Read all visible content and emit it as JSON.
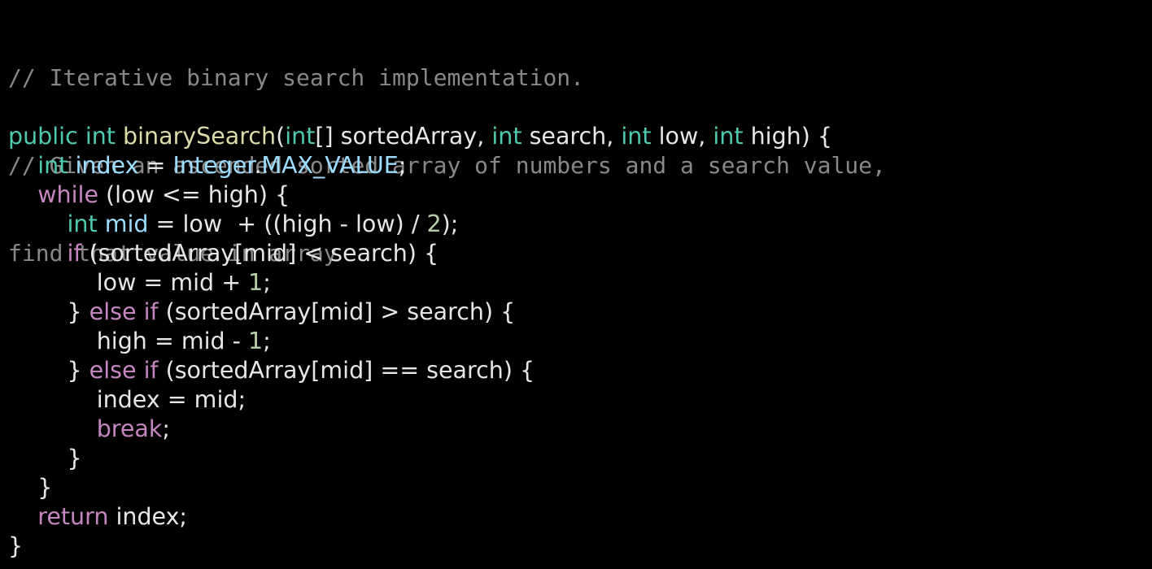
{
  "comment_lines": [
    "// Iterative binary search implementation.",
    "// Given an ascended sorted array of numbers and a search value,",
    "find that value in array"
  ],
  "code_lines": [
    [
      {
        "t": "public",
        "c": "kw"
      },
      {
        "t": " ",
        "c": "pl"
      },
      {
        "t": "int",
        "c": "kw"
      },
      {
        "t": " ",
        "c": "pl"
      },
      {
        "t": "binarySearch",
        "c": "fn"
      },
      {
        "t": "(",
        "c": "pl"
      },
      {
        "t": "int",
        "c": "kw"
      },
      {
        "t": "[] sortedArray, ",
        "c": "pl"
      },
      {
        "t": "int",
        "c": "kw"
      },
      {
        "t": " search, ",
        "c": "pl"
      },
      {
        "t": "int",
        "c": "kw"
      },
      {
        "t": " low, ",
        "c": "pl"
      },
      {
        "t": "int",
        "c": "kw"
      },
      {
        "t": " high) {",
        "c": "pl"
      }
    ],
    [
      {
        "t": "    ",
        "c": "pl"
      },
      {
        "t": "int",
        "c": "kw"
      },
      {
        "t": " ",
        "c": "pl"
      },
      {
        "t": "index",
        "c": "var"
      },
      {
        "t": " = ",
        "c": "pl"
      },
      {
        "t": "Integer",
        "c": "var"
      },
      {
        "t": ".",
        "c": "pl"
      },
      {
        "t": "MAX_VALUE",
        "c": "var"
      },
      {
        "t": ";",
        "c": "pl"
      }
    ],
    [
      {
        "t": "    ",
        "c": "pl"
      },
      {
        "t": "while",
        "c": "ctl"
      },
      {
        "t": " (low <= high) {",
        "c": "pl"
      }
    ],
    [
      {
        "t": "        ",
        "c": "pl"
      },
      {
        "t": "int",
        "c": "kw"
      },
      {
        "t": " ",
        "c": "pl"
      },
      {
        "t": "mid",
        "c": "var"
      },
      {
        "t": " = low  + ((high - low) / ",
        "c": "pl"
      },
      {
        "t": "2",
        "c": "num"
      },
      {
        "t": ");",
        "c": "pl"
      }
    ],
    [
      {
        "t": "        ",
        "c": "pl"
      },
      {
        "t": "if",
        "c": "ctl"
      },
      {
        "t": " (sortedArray[mid] < search) {",
        "c": "pl"
      }
    ],
    [
      {
        "t": "            low = mid + ",
        "c": "pl"
      },
      {
        "t": "1",
        "c": "num"
      },
      {
        "t": ";",
        "c": "pl"
      }
    ],
    [
      {
        "t": "        } ",
        "c": "pl"
      },
      {
        "t": "else",
        "c": "ctl"
      },
      {
        "t": " ",
        "c": "pl"
      },
      {
        "t": "if",
        "c": "ctl"
      },
      {
        "t": " (sortedArray[mid] > search) {",
        "c": "pl"
      }
    ],
    [
      {
        "t": "            high = mid - ",
        "c": "pl"
      },
      {
        "t": "1",
        "c": "num"
      },
      {
        "t": ";",
        "c": "pl"
      }
    ],
    [
      {
        "t": "        } ",
        "c": "pl"
      },
      {
        "t": "else",
        "c": "ctl"
      },
      {
        "t": " ",
        "c": "pl"
      },
      {
        "t": "if",
        "c": "ctl"
      },
      {
        "t": " (sortedArray[mid] == search) {",
        "c": "pl"
      }
    ],
    [
      {
        "t": "            index = mid;",
        "c": "pl"
      }
    ],
    [
      {
        "t": "            ",
        "c": "pl"
      },
      {
        "t": "break",
        "c": "ctl"
      },
      {
        "t": ";",
        "c": "pl"
      }
    ],
    [
      {
        "t": "        }",
        "c": "pl"
      }
    ],
    [
      {
        "t": "    }",
        "c": "pl"
      }
    ],
    [
      {
        "t": "    ",
        "c": "pl"
      },
      {
        "t": "return",
        "c": "ctl"
      },
      {
        "t": " index;",
        "c": "pl"
      }
    ],
    [
      {
        "t": "}",
        "c": "pl"
      }
    ]
  ],
  "colors": {
    "background": "#000000",
    "comment": "#888888",
    "keyword_type": "#4ec9b0",
    "control_keyword": "#c586c0",
    "function_name": "#dcdcaa",
    "variable": "#9cdcfe",
    "number": "#b5cea8",
    "plain": "#e6e6e6"
  }
}
